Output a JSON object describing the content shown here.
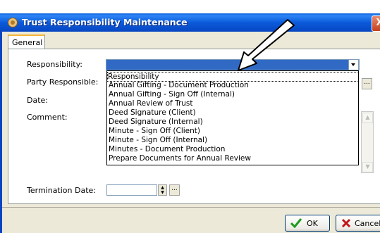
{
  "window": {
    "title": "Trust Responsibility Maintenance",
    "close_glyph": "X"
  },
  "tabs": [
    {
      "label": "General"
    }
  ],
  "form": {
    "responsibility_label": "Responsibility:",
    "party_label": "Party Responsible:",
    "date_label": "Date:",
    "comment_label": "Comment:",
    "termination_label": "Termination Date:",
    "ellipsis": "..."
  },
  "dropdown": {
    "selected": "Responsibility",
    "options": [
      "Responsibility",
      "Annual Gifting - Document Production",
      "Annual Gifting - Sign Off (Internal)",
      "Annual Review of Trust",
      "Deed Signature (Client)",
      "Deed Signature (Internal)",
      "Minute - Sign Off (Client)",
      "Minute - Sign Off (Internal)",
      "Minutes - Document Production",
      "Prepare Documents for Annual Review"
    ]
  },
  "buttons": {
    "ok": "OK",
    "cancel": "Cancel"
  },
  "colors": {
    "titlebar": "#0B5BDB",
    "selection": "#316AC5",
    "ok_check": "#1E9A1E",
    "cancel_x": "#C0141B"
  }
}
